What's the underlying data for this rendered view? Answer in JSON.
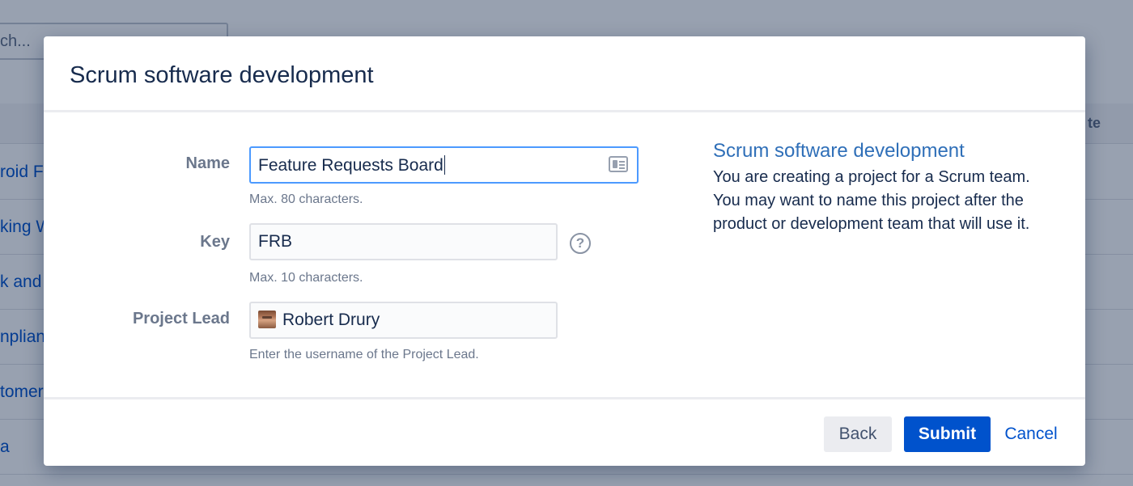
{
  "background": {
    "search_placeholder": "ch...",
    "header_cell": "te",
    "rows": [
      "roid F",
      "king W",
      "k and",
      "nplian",
      "tomer",
      "a"
    ]
  },
  "dialog": {
    "title": "Scrum software development",
    "fields": {
      "name": {
        "label": "Name",
        "value": "Feature Requests Board",
        "hint": "Max. 80 characters."
      },
      "key": {
        "label": "Key",
        "value": "FRB",
        "hint": "Max. 10 characters.",
        "help_icon": "?"
      },
      "lead": {
        "label": "Project Lead",
        "value": "Robert Drury",
        "hint": "Enter the username of the Project Lead."
      }
    },
    "info": {
      "title": "Scrum software development",
      "text": "You are creating a project for a Scrum team. You may want to name this project after the product or development team that will use it."
    },
    "buttons": {
      "back": "Back",
      "submit": "Submit",
      "cancel": "Cancel"
    }
  },
  "colors": {
    "accent": "#0052cc",
    "focus": "#4c9aff",
    "info_title": "#2f6fb8"
  }
}
